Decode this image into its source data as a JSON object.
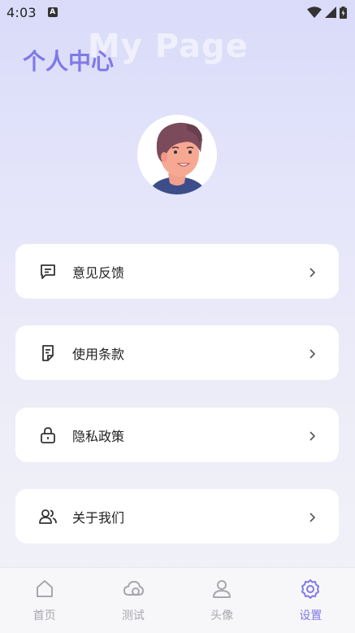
{
  "status_bar": {
    "time": "4:03",
    "notification_badge": "A"
  },
  "header": {
    "watermark": "My Page",
    "title": "个人中心"
  },
  "menu": [
    {
      "label": "意见反馈",
      "icon": "message-icon"
    },
    {
      "label": "使用条款",
      "icon": "document-icon"
    },
    {
      "label": "隐私政策",
      "icon": "lock-icon"
    },
    {
      "label": "关于我们",
      "icon": "people-icon"
    }
  ],
  "tabs": [
    {
      "label": "首页",
      "icon": "home-icon",
      "active": false
    },
    {
      "label": "测试",
      "icon": "cloud-icon",
      "active": false
    },
    {
      "label": "头像",
      "icon": "user-icon",
      "active": false
    },
    {
      "label": "设置",
      "icon": "gear-icon",
      "active": true
    }
  ],
  "colors": {
    "accent": "#7f79e6",
    "inactive": "#a7a7ae",
    "card": "#ffffff"
  }
}
